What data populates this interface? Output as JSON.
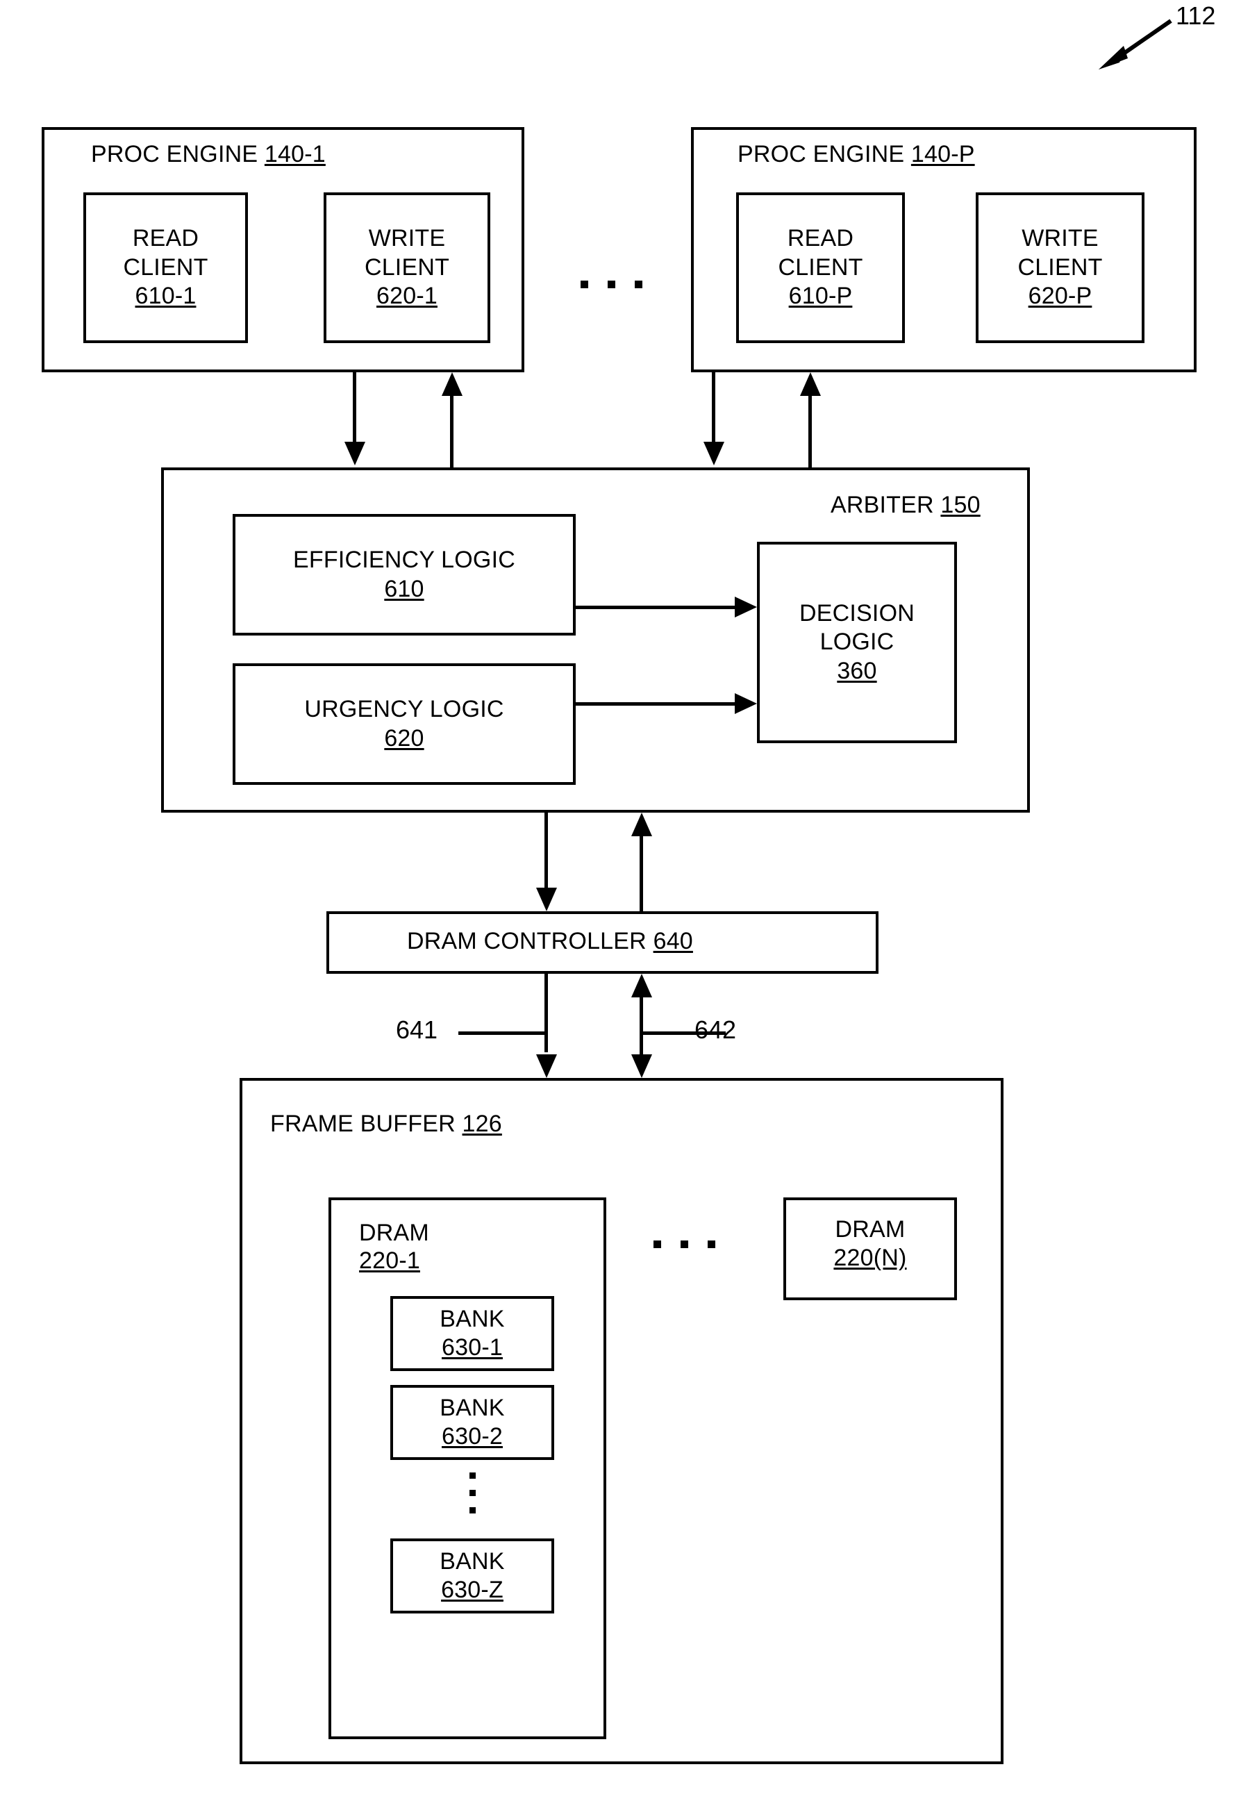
{
  "figure": {
    "reference_numeral": "112"
  },
  "proc_engines": [
    {
      "title": "PROC ENGINE",
      "title_ref": "140-1",
      "read_client": {
        "line1": "READ",
        "line2": "CLIENT",
        "ref": "610-1"
      },
      "write_client": {
        "line1": "WRITE",
        "line2": "CLIENT",
        "ref": "620-1"
      }
    },
    {
      "title": "PROC ENGINE",
      "title_ref": "140-P",
      "read_client": {
        "line1": "READ",
        "line2": "CLIENT",
        "ref": "610-P"
      },
      "write_client": {
        "line1": "WRITE",
        "line2": "CLIENT",
        "ref": "620-P"
      }
    }
  ],
  "arbiter": {
    "title": "ARBITER",
    "title_ref": "150",
    "efficiency_logic": {
      "label": "EFFICIENCY LOGIC",
      "ref": "610"
    },
    "urgency_logic": {
      "label": "URGENCY LOGIC",
      "ref": "620"
    },
    "decision_logic": {
      "line1": "DECISION",
      "line2": "LOGIC",
      "ref": "360"
    }
  },
  "dram_controller": {
    "label": "DRAM CONTROLLER",
    "ref": "640"
  },
  "bus_labels": {
    "write_bus": "641",
    "read_bus": "642"
  },
  "frame_buffer": {
    "title": "FRAME BUFFER",
    "title_ref": "126",
    "dram_first": {
      "label": "DRAM",
      "ref": "220-1"
    },
    "dram_last": {
      "label": "DRAM",
      "ref": "220(N)"
    },
    "banks": [
      {
        "label": "BANK",
        "ref": "630-1"
      },
      {
        "label": "BANK",
        "ref": "630-2"
      },
      {
        "label": "BANK",
        "ref": "630-Z"
      }
    ]
  },
  "colors": {
    "ink": "#000000",
    "paper": "#ffffff"
  }
}
